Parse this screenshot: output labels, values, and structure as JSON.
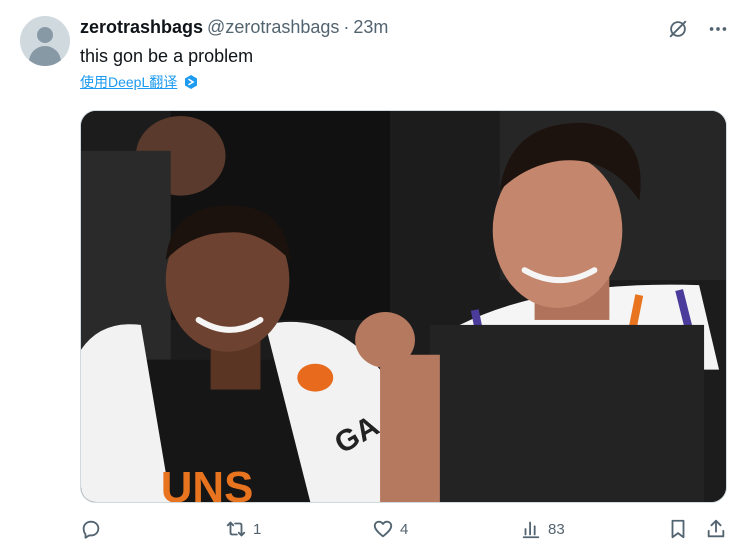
{
  "author": {
    "display_name": "zerotrashbags",
    "handle": "@zerotrashbags",
    "separator": "·",
    "time": "23m"
  },
  "tweet": {
    "text": "this gon be a problem",
    "translate_label": "使用DeepL翻译"
  },
  "media": {
    "jersey_text": "UNS",
    "towel_text": "GA"
  },
  "actions": {
    "reply_count": "",
    "retweet_count": "1",
    "like_count": "4",
    "views_count": "83"
  },
  "colors": {
    "accent": "#1d9bf0",
    "muted": "#536471",
    "text": "#0f1419"
  },
  "icons": {
    "avatar": "default-avatar-icon",
    "grok": "grok-icon",
    "more": "more-icon",
    "deepl": "deepl-icon",
    "reply": "reply-icon",
    "retweet": "retweet-icon",
    "like": "heart-icon",
    "views": "views-icon",
    "bookmark": "bookmark-icon",
    "share": "share-icon"
  }
}
